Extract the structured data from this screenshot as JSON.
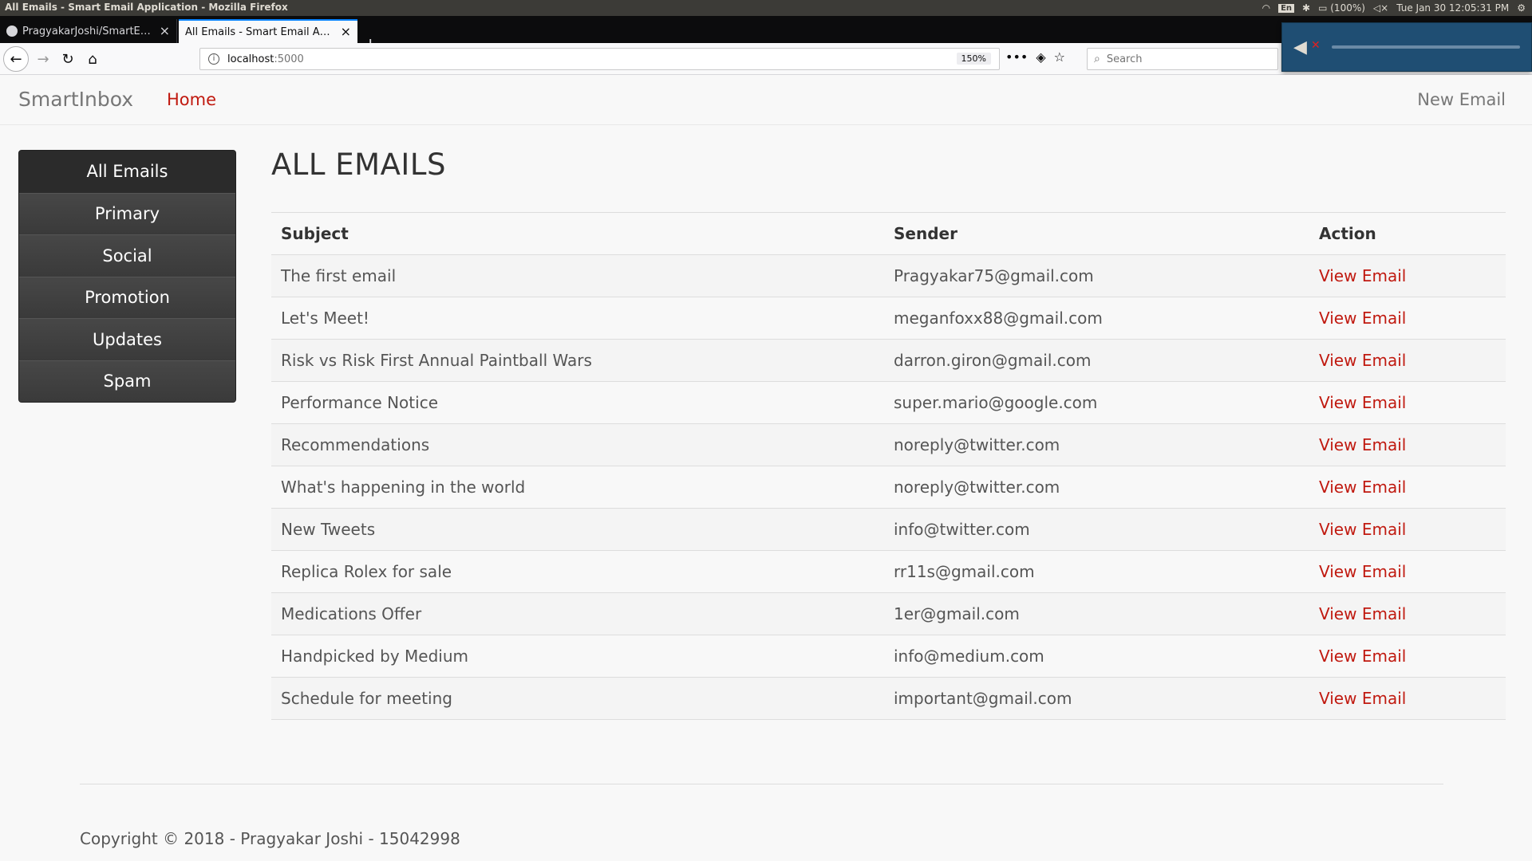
{
  "os": {
    "window_title": "All Emails - Smart Email Application - Mozilla Firefox",
    "lang": "En",
    "battery": "(100%)",
    "clock": "Tue Jan 30 12:05:31 PM"
  },
  "browser": {
    "tabs": [
      {
        "title": "PragyakarJoshi/SmartEmail"
      },
      {
        "title": "All Emails - Smart Email Application"
      }
    ],
    "url_host": "localhost",
    "url_port": ":5000",
    "zoom": "150%",
    "search_placeholder": "Search"
  },
  "app": {
    "brand": "SmartInbox",
    "nav_home": "Home",
    "nav_new_email": "New Email",
    "page_title": "ALL EMAILS",
    "sidebar": [
      {
        "label": "All Emails"
      },
      {
        "label": "Primary"
      },
      {
        "label": "Social"
      },
      {
        "label": "Promotion"
      },
      {
        "label": "Updates"
      },
      {
        "label": "Spam"
      }
    ],
    "table": {
      "headers": {
        "subject": "Subject",
        "sender": "Sender",
        "action": "Action"
      },
      "rows": [
        {
          "subject": "The first email",
          "sender": "Pragyakar75@gmail.com",
          "action": "View Email"
        },
        {
          "subject": "Let's Meet!",
          "sender": "meganfoxx88@gmail.com",
          "action": "View Email"
        },
        {
          "subject": "Risk vs Risk First Annual Paintball Wars",
          "sender": "darron.giron@gmail.com",
          "action": "View Email"
        },
        {
          "subject": "Performance Notice",
          "sender": "super.mario@google.com",
          "action": "View Email"
        },
        {
          "subject": "Recommendations",
          "sender": "noreply@twitter.com",
          "action": "View Email"
        },
        {
          "subject": "What's happening in the world",
          "sender": "noreply@twitter.com",
          "action": "View Email"
        },
        {
          "subject": "New Tweets",
          "sender": "info@twitter.com",
          "action": "View Email"
        },
        {
          "subject": "Replica Rolex for sale",
          "sender": "rr11s@gmail.com",
          "action": "View Email"
        },
        {
          "subject": "Medications Offer",
          "sender": "1er@gmail.com",
          "action": "View Email"
        },
        {
          "subject": "Handpicked by Medium",
          "sender": "info@medium.com",
          "action": "View Email"
        },
        {
          "subject": "Schedule for meeting",
          "sender": "important@gmail.com",
          "action": "View Email"
        }
      ]
    },
    "footer": "Copyright © 2018 - Pragyakar Joshi - 15042998"
  },
  "colors": {
    "link_red": "#c0190f",
    "sidebar_dark": "#3d3d3d",
    "volume_popup": "#1f4e73"
  }
}
